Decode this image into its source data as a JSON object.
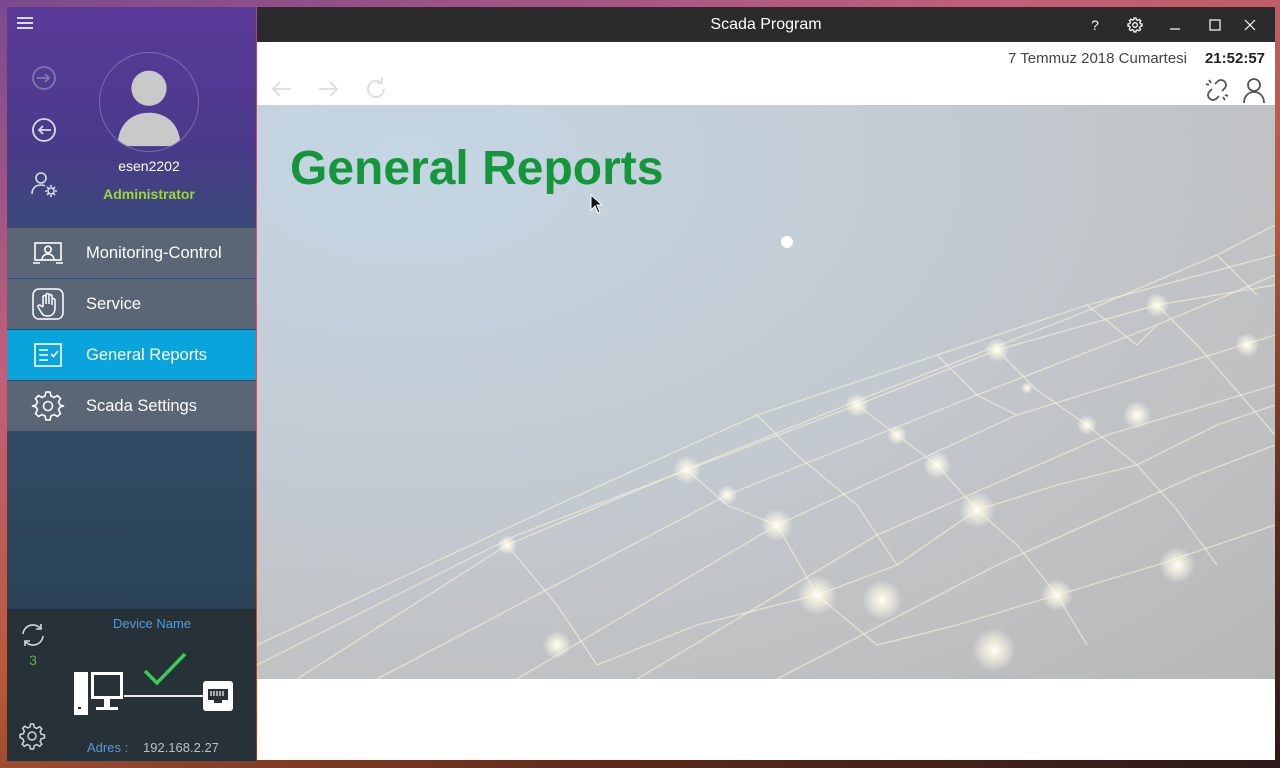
{
  "window": {
    "title": "Scada Program",
    "help_label": "?"
  },
  "header": {
    "date": "7 Temmuz 2018 Cumartesi",
    "time": "21:52:57"
  },
  "user": {
    "name": "esen2202",
    "role": "Administrator",
    "role_color": "#9ad640"
  },
  "nav": {
    "items": [
      {
        "label": "Monitoring-Control",
        "icon": "monitor-user-icon",
        "active": false
      },
      {
        "label": "Service",
        "icon": "hand-icon",
        "active": false
      },
      {
        "label": "General Reports",
        "icon": "report-checklist-icon",
        "active": true
      },
      {
        "label": "Scada Settings",
        "icon": "gear-icon",
        "active": false
      }
    ],
    "active_color": "#0aa4dc"
  },
  "status": {
    "device_name_label": "Device Name",
    "sync_count": "3",
    "address_label": "Adres :",
    "address_value": "192.168.2.27",
    "connected": true
  },
  "main": {
    "page_title": "General Reports",
    "title_color": "#14963a"
  }
}
